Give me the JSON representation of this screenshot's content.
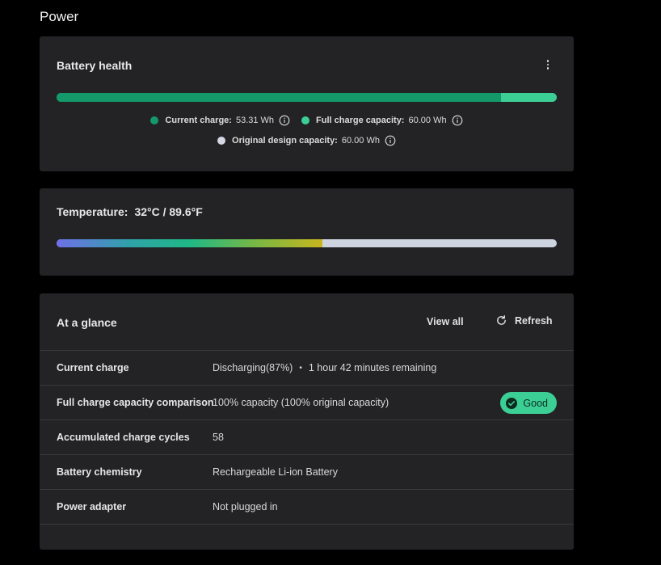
{
  "page": {
    "title": "Power"
  },
  "battery_health": {
    "title": "Battery health",
    "charge_fraction": 0.8885,
    "legend": [
      {
        "label": "Current charge:",
        "value": "53.31 Wh",
        "color": "#13996a"
      },
      {
        "label": "Full charge capacity:",
        "value": "60.00 Wh",
        "color": "#3ccf95"
      },
      {
        "label": "Original design capacity:",
        "value": "60.00 Wh",
        "color": "#d3d8e2"
      }
    ]
  },
  "temperature": {
    "label": "Temperature:",
    "value": "32°C / 89.6°F",
    "level_fraction": 0.532
  },
  "at_a_glance": {
    "title": "At a glance",
    "view_all_label": "View all",
    "refresh_label": "Refresh",
    "rows": [
      {
        "label": "Current charge",
        "value": "Discharging(87%)",
        "extra": "1 hour 42 minutes remaining"
      },
      {
        "label": "Full charge capacity comparison",
        "value": "100% capacity (100% original capacity)",
        "badge": "Good"
      },
      {
        "label": "Accumulated charge cycles",
        "value": "58"
      },
      {
        "label": "Battery chemistry",
        "value": "Rechargeable Li-ion Battery"
      },
      {
        "label": "Power adapter",
        "value": "Not plugged in"
      }
    ]
  },
  "colors": {
    "background": "#000000",
    "card": "#232326",
    "accent_green": "#3ccf95",
    "dark_green": "#13996a"
  }
}
